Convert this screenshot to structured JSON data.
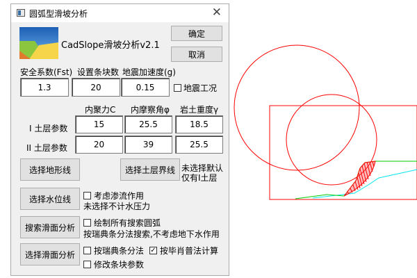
{
  "window": {
    "title": "圆弧型滑坡分析",
    "close_label": "✕"
  },
  "app": {
    "name": "CadSlope滑坡分析v2.1"
  },
  "buttons": {
    "ok": "确定",
    "cancel": "取消",
    "select_terrain": "选择地形线",
    "select_boundary": "选择土层界线",
    "select_water": "选择水位线",
    "search_slip": "搜索滑面分析",
    "choose_slip": "选择滑面分析"
  },
  "params": {
    "safety_label": "安全系数(Fst)",
    "slices_label": "设置条块数",
    "accel_label": "地震加速度(g)",
    "safety_value": "1.3",
    "slices_value": "20",
    "accel_value": "0.15",
    "seismic_label": "地震工况"
  },
  "soil": {
    "headers": [
      "内聚力C",
      "内摩察角φ",
      "岩土重度γ"
    ],
    "layer1_label": "I 土层参数",
    "layer2_label": "II 土层参数",
    "layer1_values": [
      "15",
      "25.5",
      "18.5"
    ],
    "layer2_values": [
      "20",
      "39",
      "25.5"
    ]
  },
  "notes": {
    "boundary_note_line1": "未选择默认",
    "boundary_note_line2": "仅有I土层",
    "seepage_label": "考虑渗流作用",
    "seepage_note": "未选择不计水压力",
    "draw_all_label": "绘制所有搜索圆弧",
    "search_note": "按瑞典条分法搜索,不考虑地下水作用",
    "swedish_label": "按瑞典条分法",
    "bishop_label": "按毕肖普法计算",
    "modify_label": "修改条块参数"
  },
  "checks": {
    "seismic": false,
    "seepage": false,
    "draw_all": false,
    "swedish": false,
    "bishop": true,
    "modify": false
  },
  "check_glyph": "✓",
  "colors": {
    "circle": "#ff0000",
    "terrain": "#00cc00",
    "water": "#00e5ee",
    "slice": "#ff0000"
  }
}
